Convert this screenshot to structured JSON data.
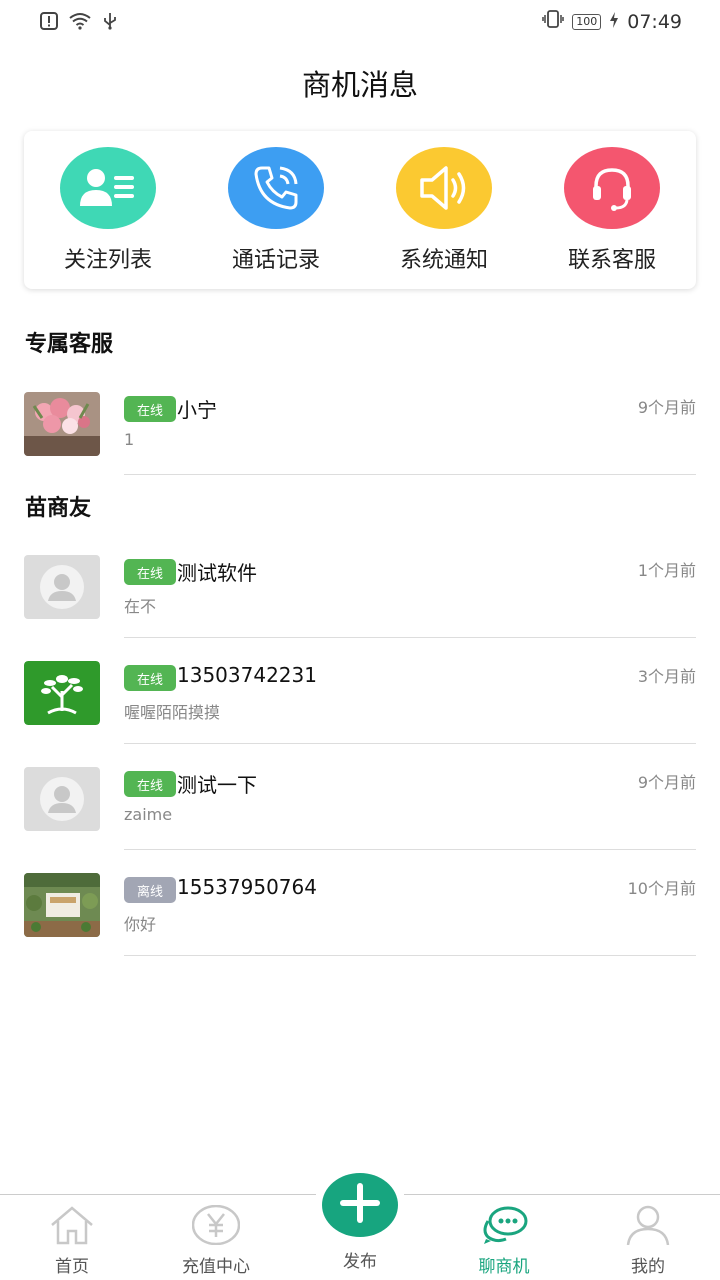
{
  "status_bar": {
    "time": "07:49",
    "battery": "100"
  },
  "page_title": "商机消息",
  "quick_actions": [
    {
      "label": "关注列表",
      "icon": "contacts-list-icon",
      "color": "#3fd8b5"
    },
    {
      "label": "通话记录",
      "icon": "phone-icon",
      "color": "#3d9ef2"
    },
    {
      "label": "系统通知",
      "icon": "speaker-icon",
      "color": "#fbc931"
    },
    {
      "label": "联系客服",
      "icon": "headset-icon",
      "color": "#f4566f"
    }
  ],
  "sections": {
    "service_title": "专属客服",
    "friends_title": "苗商友"
  },
  "service_contacts": [
    {
      "status": "在线",
      "name": "小宁",
      "preview": "1",
      "time": "9个月前"
    }
  ],
  "friend_contacts": [
    {
      "status": "在线",
      "name": "测试软件",
      "preview": "在不",
      "time": "1个月前"
    },
    {
      "status": "在线",
      "name": "13503742231",
      "preview": "喔喔陌陌摸摸",
      "time": "3个月前"
    },
    {
      "status": "在线",
      "name": "测试一下",
      "preview": "zaime",
      "time": "9个月前"
    },
    {
      "status": "离线",
      "name": "15537950764",
      "preview": "你好",
      "time": "10个月前"
    }
  ],
  "tabbar": {
    "home": "首页",
    "recharge": "充值中心",
    "publish": "发布",
    "chat": "聊商机",
    "mine": "我的"
  },
  "colors": {
    "accent": "#17a57f",
    "online": "#53b553",
    "offline": "#a2a6b4"
  }
}
